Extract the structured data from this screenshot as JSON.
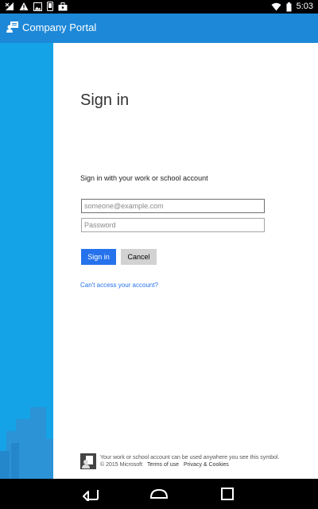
{
  "status_bar": {
    "time": "5:03",
    "icons": [
      "signal-x-icon",
      "warning-icon",
      "image-icon",
      "phone-icon",
      "briefcase-icon",
      "wifi-icon",
      "battery-icon"
    ]
  },
  "app_bar": {
    "title": "Company Portal",
    "color": "#1e88d8"
  },
  "side_panel": {
    "color": "#14a3e6"
  },
  "signin": {
    "title": "Sign in",
    "instruction": "Sign in with your work or school account",
    "email_placeholder": "someone@example.com",
    "password_placeholder": "Password",
    "signin_label": "Sign in",
    "cancel_label": "Cancel",
    "cant_access": "Can't access your account?"
  },
  "footer": {
    "info": "Your work or school account can be used anywhere you see this symbol.",
    "copyright": "© 2015 Microsoft",
    "terms": "Terms of use",
    "privacy": "Privacy & Cookies"
  },
  "nav_bar": {
    "buttons": [
      "back-icon",
      "home-icon",
      "recents-icon"
    ]
  }
}
